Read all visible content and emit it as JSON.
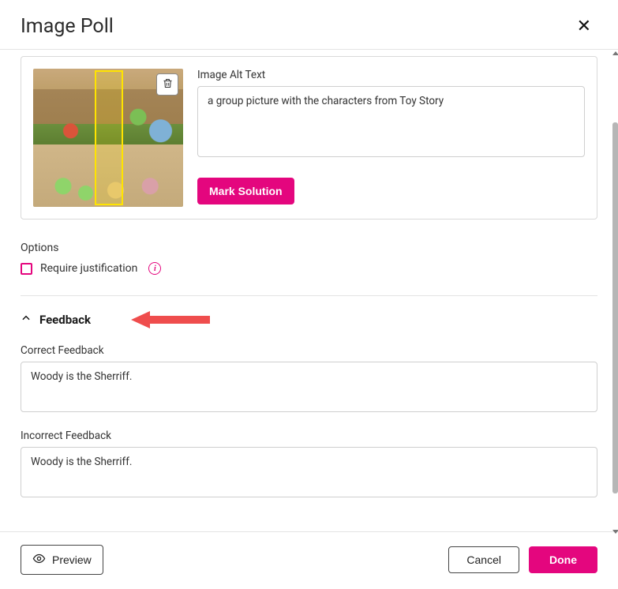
{
  "modal": {
    "title": "Image Poll"
  },
  "image": {
    "alt_text_label": "Image Alt Text",
    "alt_text_value": "a group picture with the characters from Toy Story",
    "mark_solution_label": "Mark Solution",
    "trash_icon": "trash-icon"
  },
  "options": {
    "heading": "Options",
    "require_justification_label": "Require justification",
    "require_justification_checked": false
  },
  "feedback": {
    "heading": "Feedback",
    "correct_label": "Correct Feedback",
    "correct_value": "Woody is the Sherriff.",
    "incorrect_label": "Incorrect Feedback",
    "incorrect_value": "Woody is the Sherriff."
  },
  "footer": {
    "preview_label": "Preview",
    "cancel_label": "Cancel",
    "done_label": "Done"
  }
}
